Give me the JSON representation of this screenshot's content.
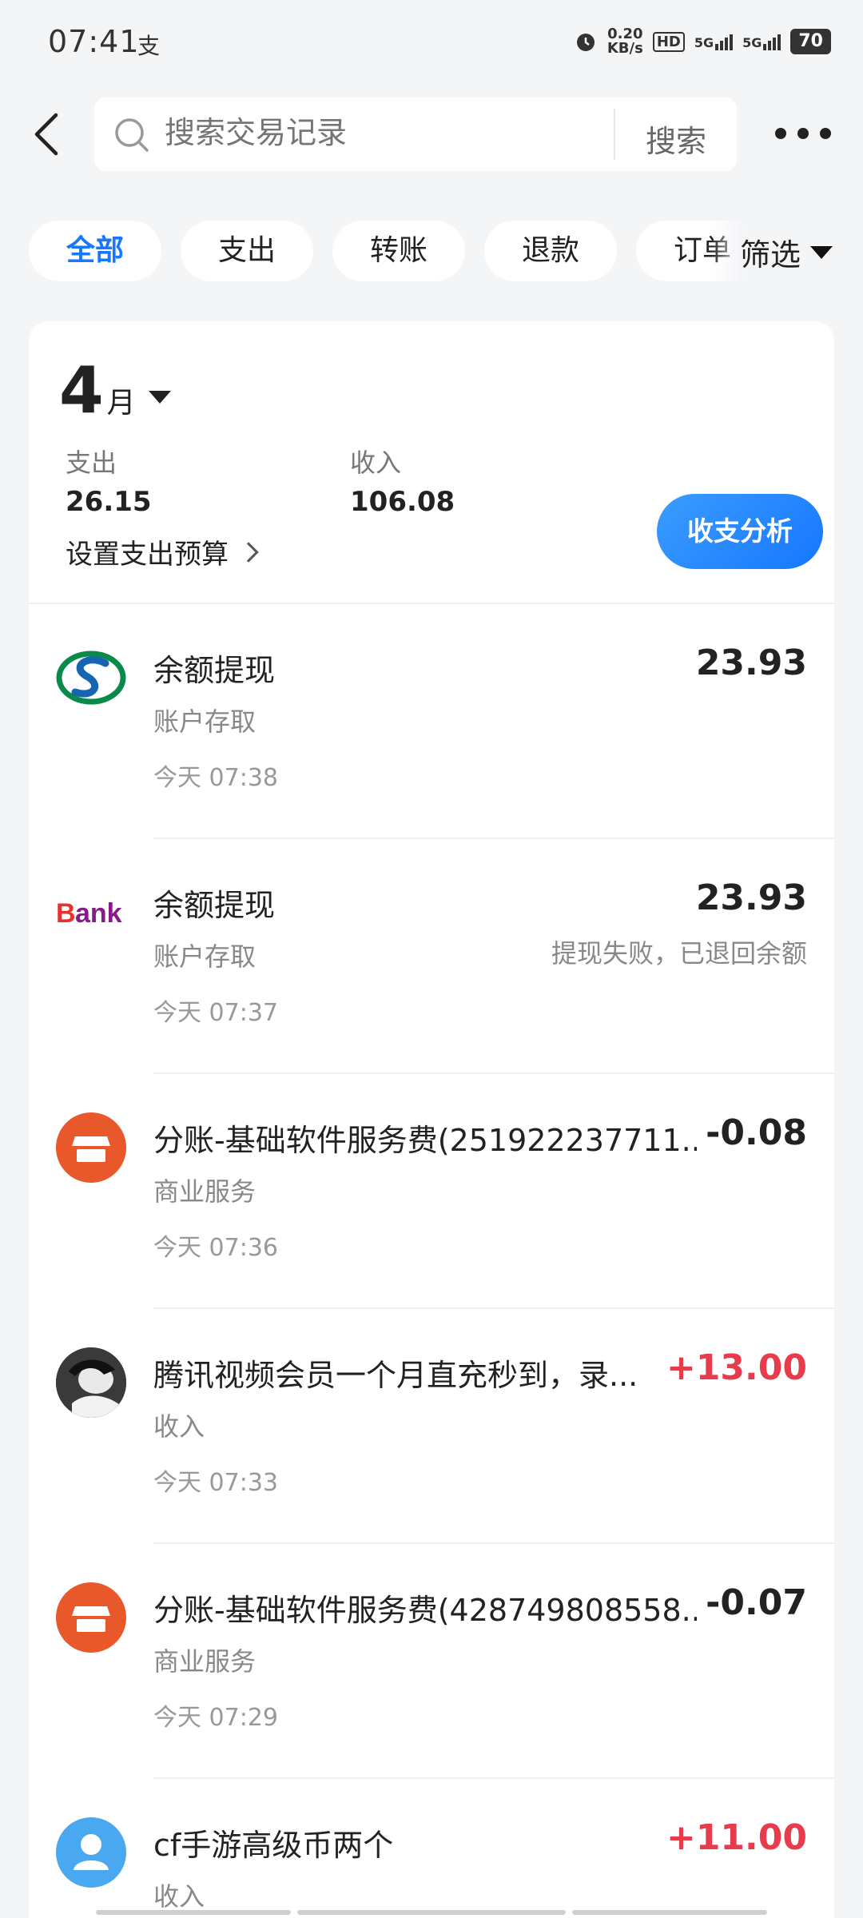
{
  "status_bar": {
    "time": "07:41",
    "app_icon_glyph": "支",
    "net_speed_value": "0.20",
    "net_speed_unit": "KB/s",
    "hd_label": "HD",
    "signal1_label": "5G",
    "signal2_label": "5G",
    "battery": "70"
  },
  "header": {
    "search_placeholder": "搜索交易记录",
    "search_button": "搜索"
  },
  "tabs": [
    {
      "label": "全部",
      "active": true
    },
    {
      "label": "支出"
    },
    {
      "label": "转账"
    },
    {
      "label": "退款"
    },
    {
      "label": "订单"
    }
  ],
  "filter_label": "筛选",
  "summary": {
    "month_number": "4",
    "month_unit": "月",
    "expense_label": "支出",
    "expense_value": "26.15",
    "income_label": "收入",
    "income_value": "106.08",
    "budget_link": "设置支出预算",
    "analysis_button": "收支分析"
  },
  "transactions": [
    {
      "title": "余额提现",
      "category": "账户存取",
      "time": "今天 07:38",
      "amount": "23.93",
      "note": "",
      "icon": "bank-logo-icon"
    },
    {
      "title": "余额提现",
      "category": "账户存取",
      "time": "今天 07:37",
      "amount": "23.93",
      "note": "提现失败，已退回余额",
      "icon": "bank-text-logo-icon"
    },
    {
      "title": "分账-基础软件服务费(251922237711...",
      "category": "商业服务",
      "time": "今天 07:36",
      "amount": "-0.08",
      "note": "",
      "icon": "store-icon"
    },
    {
      "title": "腾讯视频会员一个月直充秒到，录...",
      "category": "收入",
      "time": "今天 07:33",
      "amount": "+13.00",
      "note": "",
      "icon": "user-photo-avatar"
    },
    {
      "title": "分账-基础软件服务费(428749808558...",
      "category": "商业服务",
      "time": "今天 07:29",
      "amount": "-0.07",
      "note": "",
      "icon": "store-icon"
    },
    {
      "title": "cf手游高级币两个",
      "category": "收入",
      "time": "",
      "amount": "+11.00",
      "note": "",
      "icon": "person-icon"
    }
  ],
  "colors": {
    "accent": "#1677ff",
    "income": "#e63c4c",
    "store_icon_bg": "#e8582a",
    "person_icon_bg": "#4aa8f0"
  }
}
